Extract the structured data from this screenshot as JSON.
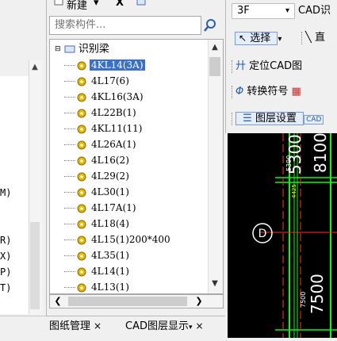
{
  "left_panel": {
    "items": [
      "M)",
      "R)",
      "X)",
      "P)",
      "T)"
    ]
  },
  "toolbar": {
    "new_label": "新建",
    "delete_label": "X"
  },
  "search": {
    "placeholder": "搜索构件..."
  },
  "tree": {
    "root_label": "识别梁",
    "items": [
      "4KL14(3A)",
      "4L17(6)",
      "4KL16(3A)",
      "4L22B(1)",
      "4KL11(11)",
      "4L26A(1)",
      "4L16(2)",
      "4L29(2)",
      "4L30(1)",
      "4L17A(1)",
      "4L18(4)",
      "4L15(1)200*400",
      "4L35(1)",
      "4L14(1)",
      "4L13(1)"
    ],
    "selected_index": 0
  },
  "bottom_tabs": {
    "tab1": "图纸管理",
    "tab2": "CAD图层显示",
    "close": "×"
  },
  "right_panel": {
    "floor": "3F",
    "cad_label": "CAD识",
    "select_label": "选择",
    "line_label": "直",
    "locate_label": "定位CAD图",
    "convert_label": "转换符号",
    "layer_label": "图层设置",
    "cad_badge": "CAD"
  },
  "canvas": {
    "labels": {
      "dim_8100": "8100",
      "dim_5300": "5300",
      "dim_7500": "7500",
      "small_5300": "5300",
      "small_4425": "4425",
      "small_7500": "7500",
      "axis_marker": "D"
    }
  },
  "colors": {
    "selection": "#3a70c8",
    "grid_green": "#00ff00",
    "grid_red": "#ff3030",
    "canvas_bg": "#000000"
  }
}
